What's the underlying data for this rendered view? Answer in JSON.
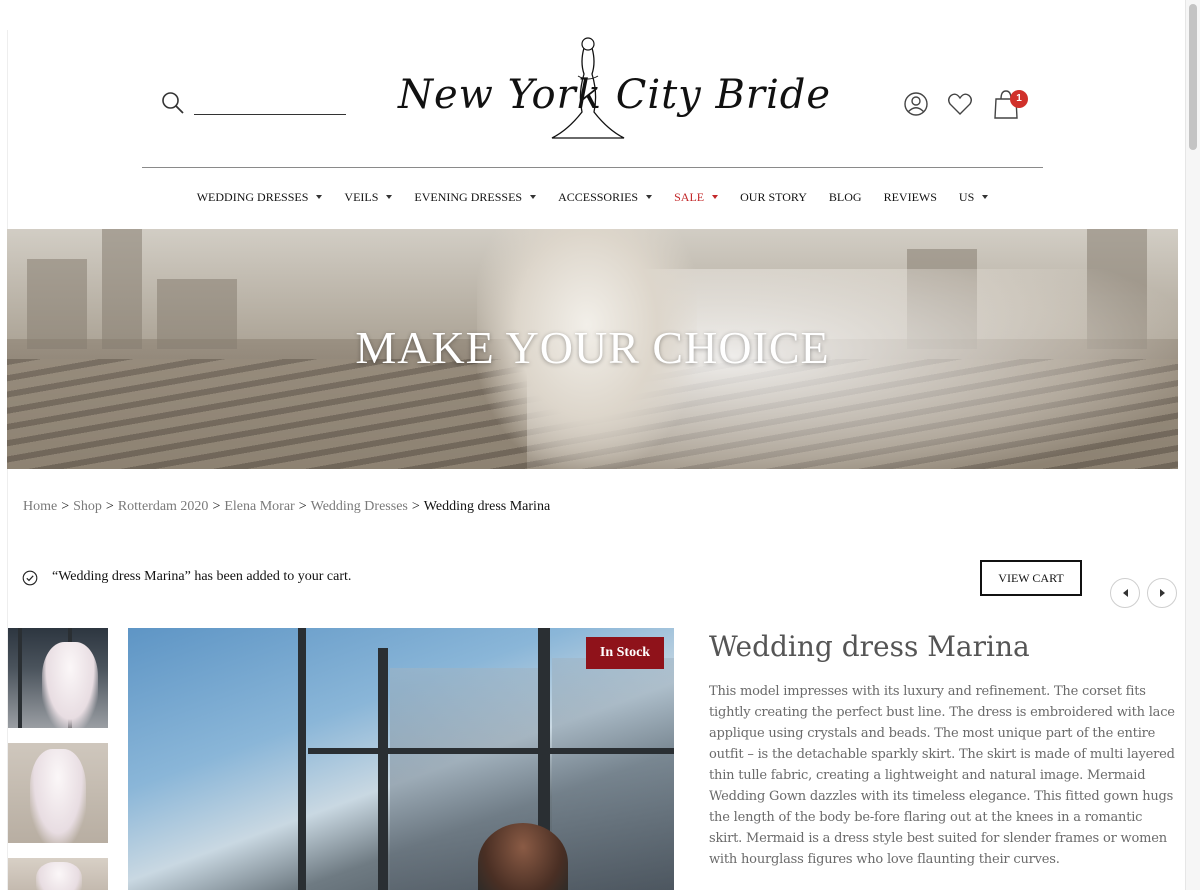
{
  "header": {
    "search": {
      "placeholder": "",
      "value": ""
    },
    "logo_text": "New York City Bride",
    "cart_count": "1",
    "icons": [
      "search-icon",
      "user-icon",
      "heart-icon",
      "shopping-bag-icon"
    ]
  },
  "nav": {
    "items": [
      {
        "label": "WEDDING DRESSES",
        "has_dropdown": true
      },
      {
        "label": "VEILS",
        "has_dropdown": true
      },
      {
        "label": "EVENING DRESSES",
        "has_dropdown": true
      },
      {
        "label": "ACCESSORIES",
        "has_dropdown": true
      },
      {
        "label": "SALE",
        "has_dropdown": true,
        "highlight": true
      },
      {
        "label": "OUR STORY",
        "has_dropdown": false
      },
      {
        "label": "BLOG",
        "has_dropdown": false
      },
      {
        "label": "REVIEWS",
        "has_dropdown": false
      },
      {
        "label": "US",
        "has_dropdown": true
      }
    ]
  },
  "hero": {
    "title": "MAKE YOUR CHOICE"
  },
  "breadcrumb": {
    "items": [
      "Home",
      "Shop",
      "Rotterdam 2020",
      "Elena Morar",
      "Wedding Dresses"
    ],
    "separator": ">",
    "current": "Wedding dress Marina"
  },
  "notice": {
    "message": "“Wedding dress Marina” has been added to your cart.",
    "button": "VIEW CART"
  },
  "product": {
    "badge": "In Stock",
    "title": "Wedding dress Marina",
    "description": "This model impresses with its luxury and refinement. The corset fits tightly creating the perfect bust line. The dress is embroidered with lace applique using crystals and beads. The most unique part of the entire outfit  – is the detachable sparkly skirt. The skirt is made of multi layered thin tulle fabric, creating a lightweight and natural image. Mermaid Wedding Gown dazzles with its timeless elegance. This fitted gown hugs the length of the body be-fore flaring out at the knees in a romantic skirt. Mermaid is a dress style best suited for slender frames or women with hourglass figures who love flaunting their curves."
  },
  "colors": {
    "sale": "#c3282a",
    "badge": "#8f121a",
    "cart_count": "#d0302a"
  }
}
